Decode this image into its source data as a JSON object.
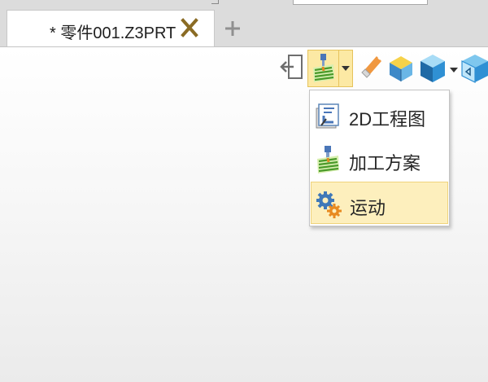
{
  "tab": {
    "title": "* 零件001.Z3PRT",
    "close_icon": "close-x-icon",
    "add_icon": "plus-icon"
  },
  "toolbar": {
    "icons": [
      "exit-icon",
      "machining-icon",
      "dropdown-arrow-icon",
      "eraser-icon",
      "cube-icon",
      "shaded-cube-icon",
      "view-cube-icon"
    ]
  },
  "menu": {
    "items": [
      {
        "label": "2D工程图",
        "icon": "drawing-icon"
      },
      {
        "label": "加工方案",
        "icon": "machining-icon"
      },
      {
        "label": "运动",
        "icon": "gears-icon",
        "highlighted": true
      }
    ]
  },
  "colors": {
    "highlight_fill": "#fdefbd",
    "highlight_border": "#efd37c",
    "tab_bar": "#dcdcdc",
    "close_x": "#8a6b24"
  }
}
